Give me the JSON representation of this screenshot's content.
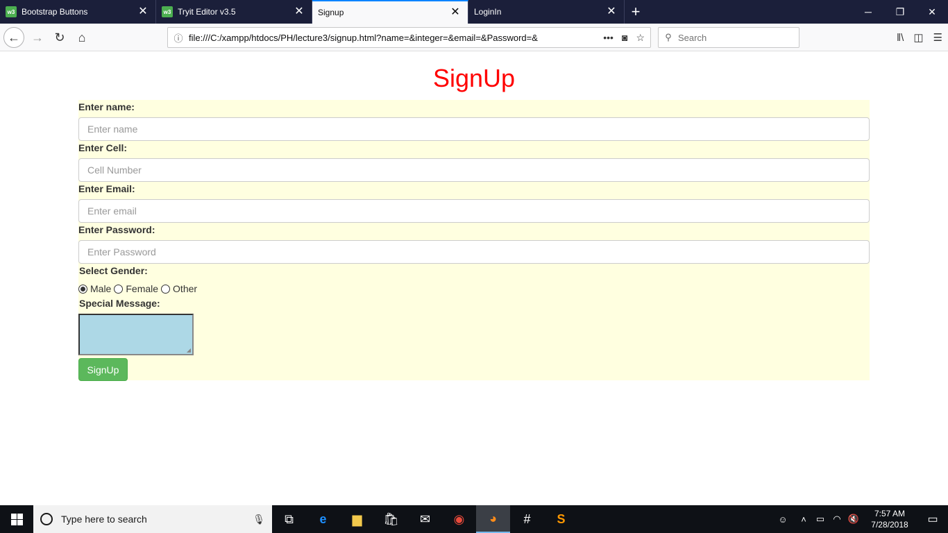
{
  "browser": {
    "tabs": [
      {
        "title": "Bootstrap Buttons",
        "favicon": "w3",
        "active": false
      },
      {
        "title": "Tryit Editor v3.5",
        "favicon": "w3",
        "active": false
      },
      {
        "title": "Signup",
        "favicon": "",
        "active": true
      },
      {
        "title": "LoginIn",
        "favicon": "",
        "active": false
      }
    ],
    "url": "file:///C:/xampp/htdocs/PH/lecture3/signup.html?name=&integer=&email=&Password=&",
    "search_placeholder": "Search"
  },
  "page": {
    "heading": "SignUp",
    "heading_color": "#ff0000",
    "form_bg": "#ffffe0",
    "fields": {
      "name": {
        "label": "Enter name:",
        "placeholder": "Enter name"
      },
      "cell": {
        "label": "Enter Cell:",
        "placeholder": "Cell Number"
      },
      "email": {
        "label": "Enter Email:",
        "placeholder": "Enter email"
      },
      "password": {
        "label": "Enter Password:",
        "placeholder": "Enter Password"
      }
    },
    "gender": {
      "label": "Select Gender:",
      "options": [
        "Male",
        "Female",
        "Other"
      ],
      "selected": "Male"
    },
    "message": {
      "label": "Special Message:"
    },
    "submit_label": "SignUp",
    "submit_color": "#5cb85c"
  },
  "taskbar": {
    "search_text": "Type here to search",
    "time": "7:57 AM",
    "date": "7/28/2018"
  }
}
